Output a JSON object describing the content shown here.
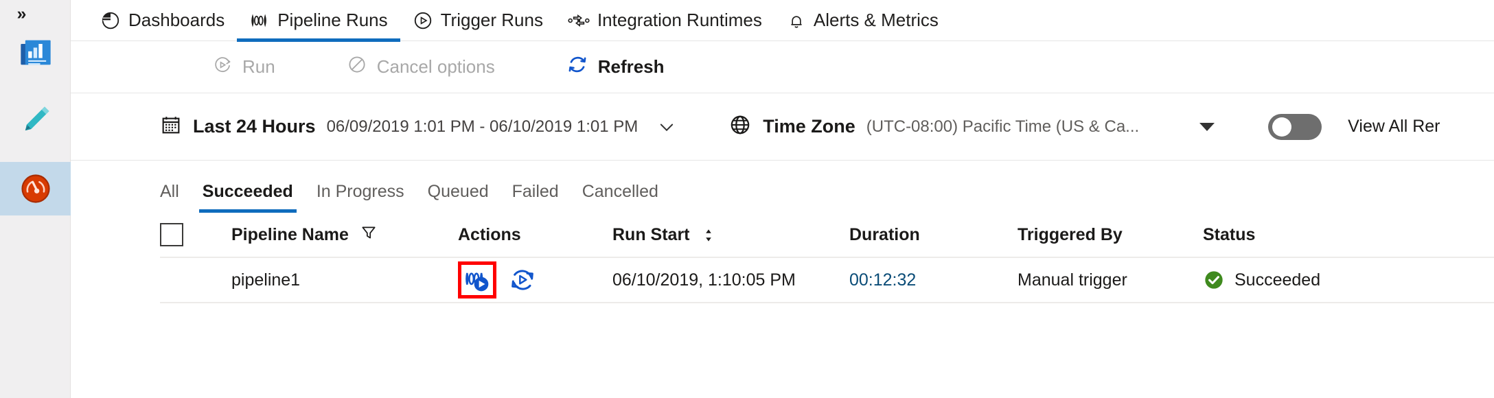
{
  "rail": {
    "expand_label": "»",
    "items": [
      {
        "name": "home-dashboard",
        "icon": "dashboard-tile-icon",
        "selected": false
      },
      {
        "name": "author-pencil",
        "icon": "pencil-icon",
        "selected": false
      },
      {
        "name": "monitor-gauge",
        "icon": "gauge-icon",
        "selected": true
      }
    ]
  },
  "nav": {
    "tabs": [
      {
        "label": "Dashboards",
        "icon": "pie-chart-icon",
        "active": false
      },
      {
        "label": "Pipeline Runs",
        "icon": "pipeline-icon",
        "active": true
      },
      {
        "label": "Trigger Runs",
        "icon": "play-circle-icon",
        "active": false
      },
      {
        "label": "Integration Runtimes",
        "icon": "integration-runtime-icon",
        "active": false
      },
      {
        "label": "Alerts & Metrics",
        "icon": "bell-icon",
        "active": false
      }
    ]
  },
  "toolbar": {
    "run_label": "Run",
    "cancel_label": "Cancel options",
    "refresh_label": "Refresh"
  },
  "filters": {
    "range_label": "Last 24 Hours",
    "range_value": "06/09/2019 1:01 PM - 06/10/2019 1:01 PM",
    "timezone_label": "Time Zone",
    "timezone_value": "(UTC-08:00) Pacific Time (US & Ca...",
    "toggle_label": "View All Rer",
    "toggle_on": false
  },
  "status_tabs": [
    {
      "label": "All",
      "active": false
    },
    {
      "label": "Succeeded",
      "active": true
    },
    {
      "label": "In Progress",
      "active": false
    },
    {
      "label": "Queued",
      "active": false
    },
    {
      "label": "Failed",
      "active": false
    },
    {
      "label": "Cancelled",
      "active": false
    }
  ],
  "table": {
    "columns": {
      "pipeline_name": "Pipeline Name",
      "actions": "Actions",
      "run_start": "Run Start",
      "duration": "Duration",
      "triggered_by": "Triggered By",
      "status": "Status"
    },
    "rows": [
      {
        "pipeline_name": "pipeline1",
        "run_start": "06/10/2019, 1:10:05 PM",
        "duration": "00:12:32",
        "triggered_by": "Manual trigger",
        "status": "Succeeded"
      }
    ]
  },
  "colors": {
    "accent_blue": "#0f6cbd",
    "action_icon_blue": "#1155cc",
    "highlight_red": "#ff0000",
    "success_green": "#3f8a1e",
    "duration_blue": "#0a4c77",
    "rail_selected": "#c3d9ea"
  }
}
